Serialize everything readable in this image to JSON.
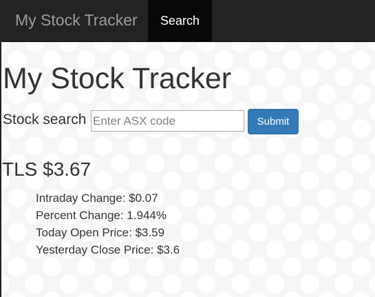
{
  "navbar": {
    "brand": "My Stock Tracker",
    "items": [
      {
        "label": "Search",
        "active": true
      }
    ]
  },
  "main": {
    "title": "My Stock Tracker",
    "search": {
      "label": "Stock search",
      "placeholder": "Enter ASX code",
      "value": "",
      "submit_label": "Submit"
    },
    "quote": {
      "heading": "TLS $3.67",
      "details": [
        "Intraday Change: $0.07",
        "Percent Change: 1.944%",
        "Today Open Price: $3.59",
        "Yesterday Close Price: $3.6"
      ]
    }
  },
  "colors": {
    "navbar_bg": "#222222",
    "active_nav_bg": "#080808",
    "brand_text": "#9d9d9d",
    "primary_button": "#337ab7",
    "body_text": "#333333"
  }
}
